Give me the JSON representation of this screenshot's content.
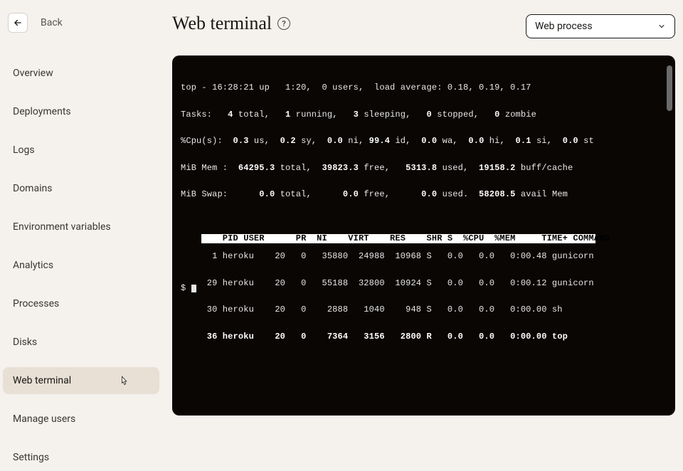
{
  "back_label": "Back",
  "page_title": "Web terminal",
  "process_select_label": "Web process",
  "sidebar": {
    "items": [
      {
        "label": "Overview"
      },
      {
        "label": "Deployments"
      },
      {
        "label": "Logs"
      },
      {
        "label": "Domains"
      },
      {
        "label": "Environment variables"
      },
      {
        "label": "Analytics"
      },
      {
        "label": "Processes"
      },
      {
        "label": "Disks"
      },
      {
        "label": "Web terminal"
      },
      {
        "label": "Manage users"
      },
      {
        "label": "Settings"
      }
    ],
    "active_index": 8
  },
  "terminal": {
    "summary": {
      "line1_a": "top - 16:28:21 up   1:20,  0 users,  load average: 0.18, 0.19, 0.17",
      "line2_a": "Tasks:",
      "line2_b": "   4 ",
      "line2_c": "total,",
      "line2_d": "   1 ",
      "line2_e": "running,",
      "line2_f": "   3 ",
      "line2_g": "sleeping,",
      "line2_h": "   0 ",
      "line2_i": "stopped,",
      "line2_j": "   0 ",
      "line2_k": "zombie",
      "line3_a": "%Cpu(s):",
      "line3_b": "  0.3 ",
      "line3_c": "us,",
      "line3_d": "  0.2 ",
      "line3_e": "sy,",
      "line3_f": "  0.0 ",
      "line3_g": "ni,",
      "line3_h": " 99.4 ",
      "line3_i": "id,",
      "line3_j": "  0.0 ",
      "line3_k": "wa,",
      "line3_l": "  0.0 ",
      "line3_m": "hi,",
      "line3_n": "  0.1 ",
      "line3_o": "si,",
      "line3_p": "  0.0 ",
      "line3_q": "st",
      "line4_a": "MiB Mem :",
      "line4_b": "  64295.3 ",
      "line4_c": "total,",
      "line4_d": "  39823.3 ",
      "line4_e": "free,",
      "line4_f": "   5313.8 ",
      "line4_g": "used,",
      "line4_h": "  19158.2 ",
      "line4_i": "buff/cache",
      "line5_a": "MiB Swap:",
      "line5_b": "      0.0 ",
      "line5_c": "total,",
      "line5_d": "      0.0 ",
      "line5_e": "free,",
      "line5_f": "      0.0 ",
      "line5_g": "used.",
      "line5_h": "  58208.5 ",
      "line5_i": "avail Mem"
    },
    "header_row": "    PID USER      PR  NI    VIRT    RES    SHR S  %CPU  %MEM     TIME+ COMMAND ",
    "rows": [
      "      1 heroku    20   0   35880  24988  10968 S   0.0   0.0   0:00.48 gunicorn",
      "     29 heroku    20   0   55188  32800  10924 S   0.0   0.0   0:00.12 gunicorn",
      "     30 heroku    20   0    2888   1040    948 S   0.0   0.0   0:00.00 sh",
      "     36 heroku    20   0    7364   3156   2800 R   0.0   0.0   0:00.00 top"
    ],
    "prompt": "$ "
  }
}
